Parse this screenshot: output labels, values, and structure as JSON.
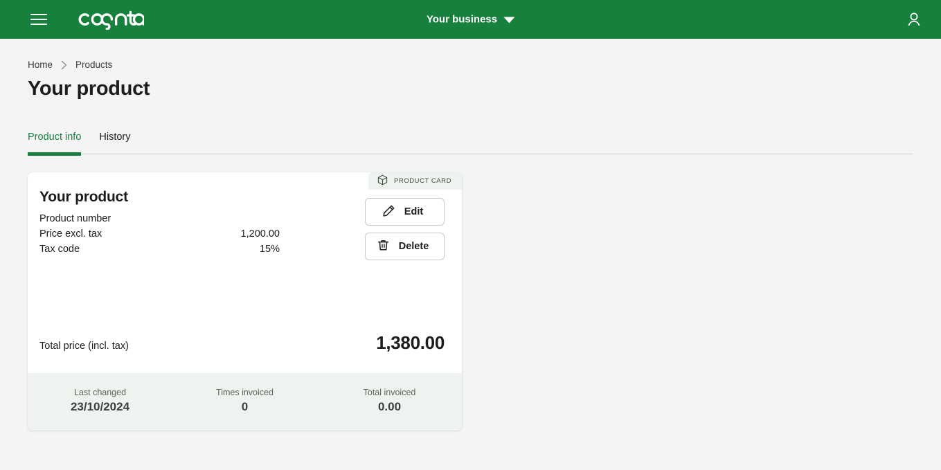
{
  "topbar": {
    "menu_icon": "hamburger-menu-icon",
    "logo_text": "conta",
    "business_switcher_label": "Your business",
    "caret_icon": "chevron-down-icon",
    "user_icon": "user-account-icon",
    "background_color": "#16803c"
  },
  "breadcrumb": {
    "items": [
      {
        "label": "Home"
      },
      {
        "label": "Products"
      }
    ],
    "separator_icon": "chevron-right-icon"
  },
  "page": {
    "title": "Your product"
  },
  "tabs": [
    {
      "label": "Product info",
      "active": true
    },
    {
      "label": "History",
      "active": false
    }
  ],
  "card": {
    "tab_label": "PRODUCT CARD",
    "tab_icon": "cube-box-icon",
    "title": "Your product",
    "rows": [
      {
        "label": "Product number",
        "value": ""
      },
      {
        "label": "Price excl. tax",
        "value": "1,200.00"
      },
      {
        "label": "Tax code",
        "value": "15%"
      }
    ],
    "actions": [
      {
        "label": "Edit",
        "icon": "pencil-edit-icon"
      },
      {
        "label": "Delete",
        "icon": "trash-delete-icon"
      }
    ],
    "total": {
      "label": "Total price (incl. tax)",
      "value": "1,380.00"
    },
    "footer_stats": [
      {
        "label": "Last changed",
        "value": "23/10/2024"
      },
      {
        "label": "Times invoiced",
        "value": "0"
      },
      {
        "label": "Total invoiced",
        "value": "0.00"
      }
    ]
  },
  "colors": {
    "brand_green": "#16803c",
    "page_background": "#f4f4f4",
    "card_background": "#ffffff",
    "card_footer_background": "#eef3f0",
    "card_tab_background": "#eef3ef"
  }
}
